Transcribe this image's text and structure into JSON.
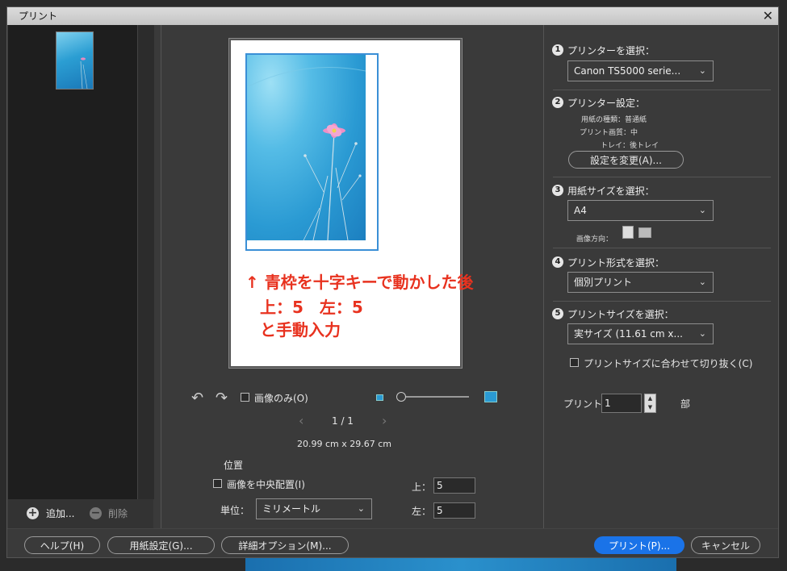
{
  "window": {
    "title": "プリント",
    "close_symbol": "✕"
  },
  "left_panel": {
    "add_label": "追加...",
    "delete_label": "削除"
  },
  "preview": {
    "annotation_line1": "↑ 青枠を十字キーで動かした後",
    "annotation_line2": "上：5　左：5",
    "annotation_line3": "と手動入力"
  },
  "controls": {
    "image_only_label": "画像のみ(O)",
    "page_indicator": "1 / 1",
    "paper_dimensions": "20.99 cm x 29.67 cm"
  },
  "position": {
    "section_label": "位置",
    "center_label": "画像を中央配置(I)",
    "unit_label": "単位：",
    "unit_value": "ミリメートル",
    "top_label": "上：",
    "top_value": "5",
    "left_label": "左：",
    "left_value": "5"
  },
  "steps": {
    "s1": {
      "num": "1",
      "label": "プリンターを選択：",
      "value": "Canon TS5000 serie..."
    },
    "s2": {
      "num": "2",
      "label": "プリンター設定：",
      "paper_type": "用紙の種類：普通紙",
      "print_quality": "プリント画質：中",
      "tray": "トレイ：後トレイ",
      "change_button": "設定を変更(A)..."
    },
    "s3": {
      "num": "3",
      "label": "用紙サイズを選択：",
      "value": "A4",
      "orientation_label": "画像方向："
    },
    "s4": {
      "num": "4",
      "label": "プリント形式を選択：",
      "value": "個別プリント"
    },
    "s5": {
      "num": "5",
      "label": "プリントサイズを選択：",
      "value": "実サイズ (11.61 cm x...",
      "crop_label": "プリントサイズに合わせて切り抜く(C)"
    }
  },
  "copies": {
    "label": "プリント",
    "value": "1",
    "unit": "部"
  },
  "footer": {
    "help": "ヘルプ(H)",
    "page_setup": "用紙設定(G)...",
    "more_options": "詳細オプション(M)...",
    "print": "プリント(P)...",
    "cancel": "キャンセル"
  }
}
